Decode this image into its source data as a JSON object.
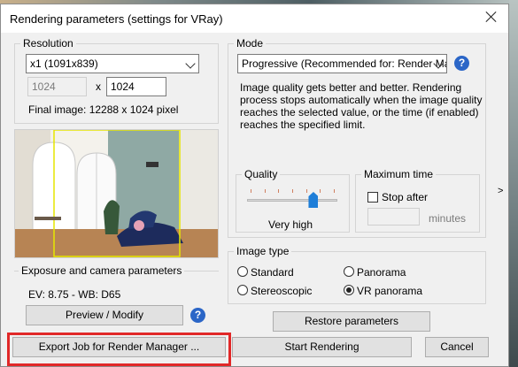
{
  "dialog": {
    "title": "Rendering parameters (settings for VRay)",
    "colors": {
      "accent": "#2b66c7",
      "highlight": "#e12828",
      "slider": "#1e7ed8"
    }
  },
  "resolution": {
    "label": "Resolution",
    "select_value": "x1 (1091x839)",
    "width_value": "1024",
    "times": "x",
    "height_value": "1024",
    "final_image": "Final image: 12288 x 1024 pixel"
  },
  "mode": {
    "label": "Mode",
    "select_value": "Progressive (Recommended for: Render Man",
    "description_lines": [
      "Image quality gets better and better. Rendering",
      "process stops automatically when the image quality",
      "reaches the selected value, or the time (if enabled)",
      "reaches the specified limit."
    ]
  },
  "quality": {
    "label": "Quality",
    "value_text": "Very high",
    "level_fraction": 0.73
  },
  "max_time": {
    "label": "Maximum time",
    "stop_after_label": "Stop after",
    "stop_after_checked": false,
    "minutes_label": "minutes"
  },
  "exposure": {
    "label": "Exposure and camera parameters",
    "values": "EV: 8.75 - WB: D65",
    "preview_button": "Preview / Modify"
  },
  "image_type": {
    "label": "Image type",
    "options": [
      {
        "label": "Standard",
        "selected": false
      },
      {
        "label": "Panorama",
        "selected": false
      },
      {
        "label": "Stereoscopic",
        "selected": false
      },
      {
        "label": "VR panorama",
        "selected": true
      }
    ]
  },
  "buttons": {
    "restore": "Restore parameters",
    "export": "Export Job for Render Manager ...",
    "start": "Start Rendering",
    "cancel": "Cancel"
  },
  "side_arrow": ">",
  "help_glyph": "?"
}
